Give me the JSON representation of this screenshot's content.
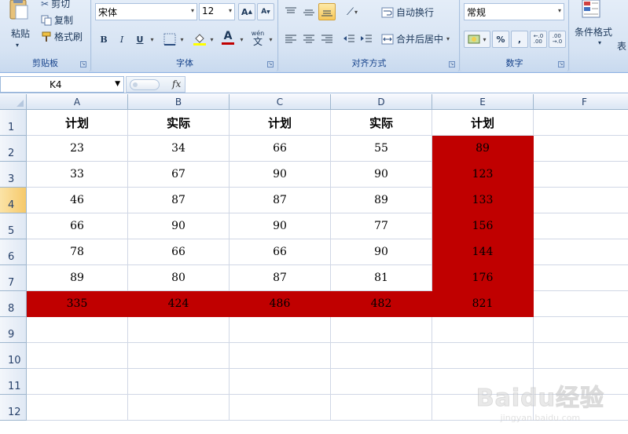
{
  "ribbon": {
    "clipboard": {
      "paste_label": "粘贴",
      "cut_label": "剪切",
      "copy_label": "复制",
      "format_painter_label": "格式刷",
      "group_label": "剪贴板"
    },
    "font": {
      "font_name": "宋体",
      "font_size": "12",
      "bold_label": "B",
      "italic_label": "I",
      "underline_label": "U",
      "font_color_label": "A",
      "phonetic_label": "wén",
      "group_label": "字体"
    },
    "alignment": {
      "wrap_text_label": "自动换行",
      "merge_center_label": "合并后居中",
      "group_label": "对齐方式"
    },
    "number": {
      "format_value": "常规",
      "percent_label": "%",
      "comma_label": ",",
      "group_label": "数字"
    },
    "styles": {
      "conditional_format_label": "条件格式",
      "table_label": "表"
    }
  },
  "formula_bar": {
    "name_box_value": "K4",
    "fx_label": "fx",
    "formula_value": ""
  },
  "sheet": {
    "columns": [
      "A",
      "B",
      "C",
      "D",
      "E",
      "F"
    ],
    "rows": [
      "1",
      "2",
      "3",
      "4",
      "5",
      "6",
      "7",
      "8",
      "9",
      "10",
      "11",
      "12"
    ],
    "active_row": "4",
    "highlight_color": "#c00000",
    "headers": [
      "计划",
      "实际",
      "计划",
      "实际",
      "计划"
    ],
    "data": [
      [
        "23",
        "34",
        "66",
        "55",
        "89"
      ],
      [
        "33",
        "67",
        "90",
        "90",
        "123"
      ],
      [
        "46",
        "87",
        "87",
        "89",
        "133"
      ],
      [
        "66",
        "90",
        "90",
        "77",
        "156"
      ],
      [
        "78",
        "66",
        "66",
        "90",
        "144"
      ],
      [
        "89",
        "80",
        "87",
        "81",
        "176"
      ],
      [
        "335",
        "424",
        "486",
        "482",
        "821"
      ]
    ]
  },
  "watermark": {
    "logo_text": "Baidu经验",
    "url_text": "jingyan.baidu.com"
  }
}
